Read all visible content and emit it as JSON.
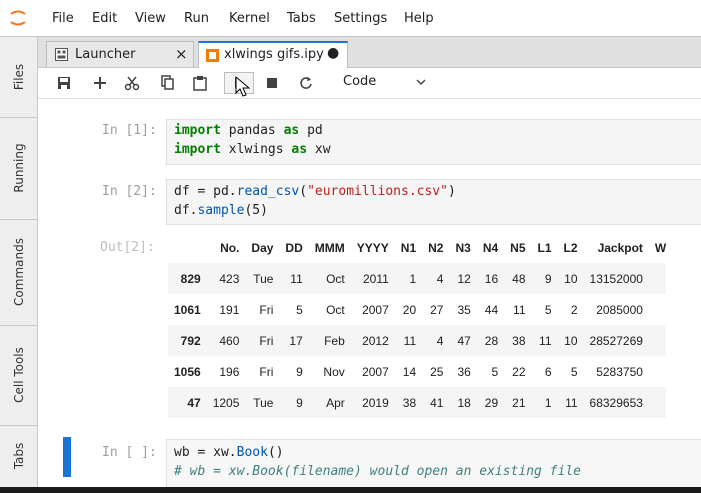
{
  "menubar": {
    "items": [
      "File",
      "Edit",
      "View",
      "Run",
      "Kernel",
      "Tabs",
      "Settings",
      "Help"
    ]
  },
  "sidebar": {
    "tabs": [
      "Files",
      "Running",
      "Commands",
      "Cell Tools",
      "Tabs"
    ]
  },
  "tabs": [
    {
      "label": "Launcher",
      "icon": "launcher-icon",
      "control": "×"
    },
    {
      "label": "xlwings gifs.ipy",
      "icon": "notebook-icon",
      "control": "●"
    }
  ],
  "toolbar": {
    "cell_type": "Code",
    "buttons": [
      "save-icon",
      "add-cell-icon",
      "cut-icon",
      "copy-icon",
      "paste-icon",
      "run-icon",
      "stop-icon",
      "restart-icon"
    ]
  },
  "cells": [
    {
      "prompt": "In [1]:"
    },
    {
      "prompt": "In [2]:",
      "output_prompt": "Out[2]:"
    },
    {
      "prompt": "In [ ]:"
    }
  ],
  "code": {
    "cell1": {
      "kw1": "import",
      "mod1": " pandas ",
      "kw2": "as",
      "alias1": " pd",
      "kw3": "import",
      "mod2": " xlwings ",
      "kw4": "as",
      "alias2": " xw"
    },
    "cell2": {
      "l1a": "df = pd.",
      "l1b": "read_csv",
      "l1c": "(",
      "l1d": "\"euromillions.csv\"",
      "l1e": ")",
      "l2a": "df.",
      "l2b": "sample",
      "l2c": "(5)"
    },
    "cell3": {
      "l1a": "wb = xw.",
      "l1b": "Book",
      "l1c": "()",
      "l2": "# wb = xw.Book(filename) would open an existing file"
    }
  },
  "dataframe": {
    "columns": [
      "No.",
      "Day",
      "DD",
      "MMM",
      "YYYY",
      "N1",
      "N2",
      "N3",
      "N4",
      "N5",
      "L1",
      "L2",
      "Jackpot",
      "W"
    ],
    "rows": [
      {
        "index": "829",
        "values": [
          "423",
          "Tue",
          "11",
          "Oct",
          "2011",
          "1",
          "4",
          "12",
          "16",
          "48",
          "9",
          "10",
          "13152000"
        ]
      },
      {
        "index": "1061",
        "values": [
          "191",
          "Fri",
          "5",
          "Oct",
          "2007",
          "20",
          "27",
          "35",
          "44",
          "11",
          "5",
          "2",
          "2085000"
        ]
      },
      {
        "index": "792",
        "values": [
          "460",
          "Fri",
          "17",
          "Feb",
          "2012",
          "11",
          "4",
          "47",
          "28",
          "38",
          "11",
          "10",
          "28527269"
        ]
      },
      {
        "index": "1056",
        "values": [
          "196",
          "Fri",
          "9",
          "Nov",
          "2007",
          "14",
          "25",
          "36",
          "5",
          "22",
          "6",
          "5",
          "5283750"
        ]
      },
      {
        "index": "47",
        "values": [
          "1205",
          "Tue",
          "9",
          "Apr",
          "2019",
          "38",
          "41",
          "18",
          "29",
          "21",
          "1",
          "11",
          "68329653"
        ]
      }
    ]
  },
  "colors": {
    "accent": "#1976d2",
    "tab_icon": "#f57c00",
    "logo": "#f37726"
  }
}
